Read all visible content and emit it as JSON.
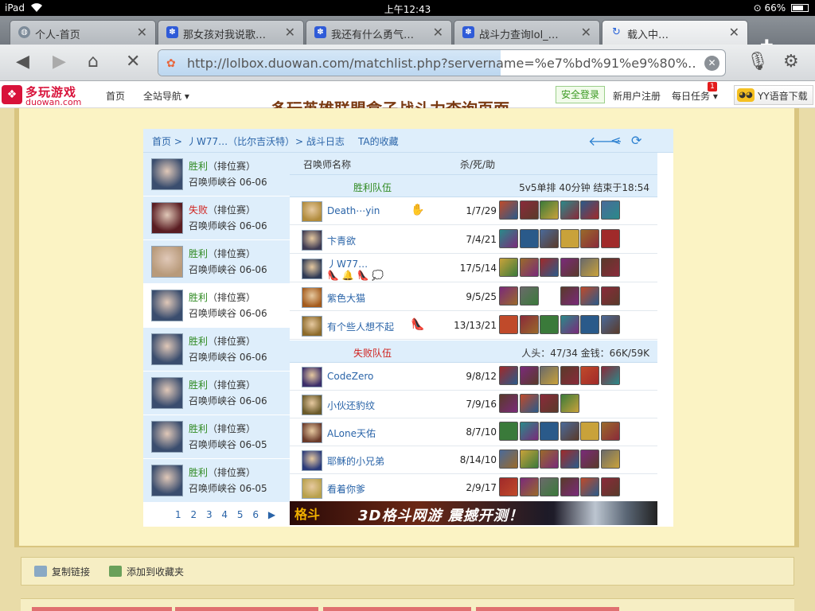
{
  "status": {
    "device": "iPad",
    "time": "上午12:43",
    "battery": "66%"
  },
  "browser": {
    "tabs": [
      {
        "title": "个人-首页",
        "icon": "globe-icon"
      },
      {
        "title": "那女孩对我说歌…",
        "icon": "baidu-paw-icon"
      },
      {
        "title": "我还有什么勇气…",
        "icon": "baidu-paw-icon"
      },
      {
        "title": "战斗力查询lol_…",
        "icon": "baidu-paw-icon"
      },
      {
        "title": "载入中…",
        "icon": "loading-icon"
      }
    ],
    "url": "http://lolbox.duowan.com/matchlist.php?servername=%e7%bd%91%e9%80%…"
  },
  "sitenav": {
    "logo_cn": "多玩游戏",
    "logo_en": "duowan.com",
    "home": "首页",
    "nav": "全站导航",
    "safe_login": "安全登录",
    "register": "新用户注册",
    "daily": "每日任务",
    "daily_badge": "1",
    "yy": "YY语音下载"
  },
  "page": {
    "clipped_title": "多玩英雄联盟盒子战斗力查询页面",
    "crumb": {
      "home": "首页 >",
      "player": "丿W77…（比尔吉沃特）",
      "log": "> 战斗日志",
      "fav": "TA的收藏"
    },
    "matches": [
      {
        "result": "胜利",
        "win": true,
        "type": "（排位赛）",
        "map": "召唤师峡谷 06-06",
        "color": "#3a4d6e"
      },
      {
        "result": "失败",
        "win": false,
        "type": "（排位赛）",
        "map": "召唤师峡谷 06-06",
        "color": "#5a1d22"
      },
      {
        "result": "胜利",
        "win": true,
        "type": "（排位赛）",
        "map": "召唤师峡谷 06-06",
        "color": "#b89a7a"
      },
      {
        "result": "胜利",
        "win": true,
        "type": "（排位赛）",
        "map": "召唤师峡谷 06-06",
        "color": "#3a4d6e"
      },
      {
        "result": "胜利",
        "win": true,
        "type": "（排位赛）",
        "map": "召唤师峡谷 06-06",
        "color": "#3a4d6e"
      },
      {
        "result": "胜利",
        "win": true,
        "type": "（排位赛）",
        "map": "召唤师峡谷 06-06",
        "color": "#3a4d6e"
      },
      {
        "result": "胜利",
        "win": true,
        "type": "（排位赛）",
        "map": "召唤师峡谷 06-05",
        "color": "#3a4d6e"
      },
      {
        "result": "胜利",
        "win": true,
        "type": "（排位赛）",
        "map": "召唤师峡谷 06-05",
        "color": "#3a4d6e"
      }
    ],
    "pager": [
      "1",
      "2",
      "3",
      "4",
      "5",
      "6"
    ],
    "header": {
      "name": "召唤师名称",
      "kda": "杀/死/助"
    },
    "win_team": {
      "label": "胜利队伍",
      "info": "5v5单排 40分钟 结束于18:54"
    },
    "lose_team": {
      "label": "失败队伍",
      "info": "人头：47/34 金钱：66K/59K"
    },
    "win_players": [
      {
        "name": "Death⋯yin",
        "kda": "1/7/29",
        "tail": "✋",
        "color": "#b08a3a"
      },
      {
        "name": "卞青欲",
        "kda": "7/4/21",
        "tail": "",
        "color": "#3d3a52"
      },
      {
        "name": "丿W77…",
        "kda": "17/5/14",
        "tail": "",
        "buffs": "👠 🔔 👠 💭",
        "color": "#2e3a55"
      },
      {
        "name": "紫色大猫",
        "kda": "9/5/25",
        "tail": "",
        "color": "#a35a1c"
      },
      {
        "name": "有个些人想不起",
        "kda": "13/13/21",
        "tail": "👠",
        "color": "#8c6a2a"
      }
    ],
    "lose_players": [
      {
        "name": "CodeZero",
        "kda": "9/8/12",
        "color": "#3b2e6a"
      },
      {
        "name": "小伙还豹纹",
        "kda": "7/9/16",
        "color": "#6a5a2a"
      },
      {
        "name": "ALone天佑",
        "kda": "8/7/10",
        "color": "#6a3a2a"
      },
      {
        "name": "耶稣的小兄弟",
        "kda": "8/14/10",
        "color": "#2a3a7a"
      },
      {
        "name": "看着你爹",
        "kda": "2/9/17",
        "color": "#b8a04a"
      }
    ],
    "banner": {
      "logo": "格斗",
      "text": "3D格斗网游 震撼开测！"
    }
  },
  "actions": {
    "copy": "复制链接",
    "fav": "添加到收藏夹"
  },
  "item_palette": [
    "#8a2a3a",
    "#c9a23a",
    "#5a3a2a",
    "#2a5a8a",
    "#7a2a7a",
    "#3a7a3a",
    "#9a6a2a",
    "#c04a2a",
    "#4a6a9a",
    "#6a6a6a",
    "#2a8a8a",
    "#a02a2a"
  ]
}
